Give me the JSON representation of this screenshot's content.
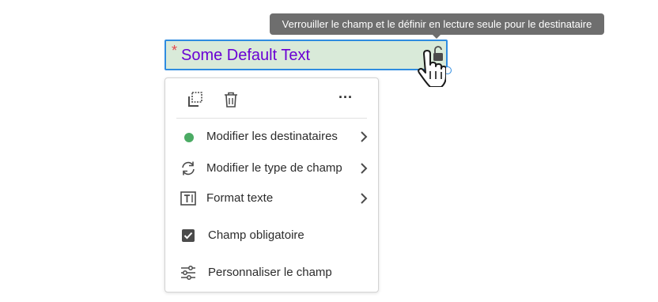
{
  "tooltip": {
    "text": "Verrouiller le champ et le définir en lecture seule pour le destinataire"
  },
  "field": {
    "required_mark": "*",
    "value": "Some Default Text"
  },
  "menu": {
    "items": [
      {
        "label": "Modifier les destinataires",
        "icon": "recipient-dot",
        "color": "#4bab64",
        "has_submenu": true
      },
      {
        "label": "Modifier le type de champ",
        "icon": "refresh-icon",
        "has_submenu": true
      },
      {
        "label": "Format texte",
        "icon": "text-format-icon",
        "has_submenu": true
      },
      {
        "label": "Champ obligatoire",
        "icon": "checkbox",
        "checked": true,
        "has_submenu": false
      },
      {
        "label": "Personnaliser le champ",
        "icon": "sliders-icon",
        "has_submenu": false
      }
    ],
    "more_label": "···"
  },
  "colors": {
    "field_bg": "#d9ead9",
    "field_border": "#2f8ce0",
    "field_text": "#6a00d4",
    "required": "#e34850",
    "tooltip_bg": "#6e6e6e"
  }
}
